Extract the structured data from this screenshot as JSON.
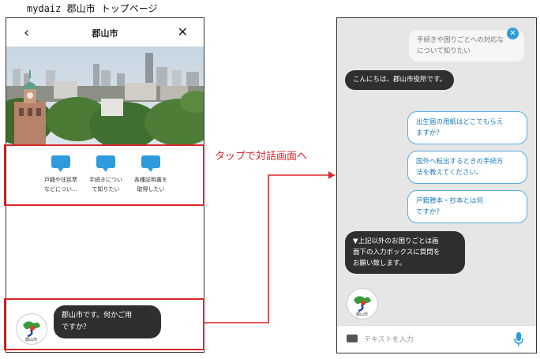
{
  "caption": "mydaiz 郡山市 トップページ",
  "left_phone": {
    "back_icon": "chevron-left-icon",
    "title": "郡山市",
    "close_icon": "close-icon",
    "photo": "city-skyline-photo",
    "actions": [
      {
        "icon": "speech-bubble-icon",
        "line1": "戸籍や住民票",
        "line2": "などについ…"
      },
      {
        "icon": "speech-bubble-icon",
        "line1": "手続きについ",
        "line2": "て知りたい"
      },
      {
        "icon": "speech-bubble-icon",
        "line1": "各種証明書を",
        "line2": "取得したい"
      }
    ],
    "greeting": {
      "line1": "郡山市です。何かご用",
      "line2": "ですか？"
    },
    "logo_text": "郡山市"
  },
  "annotation": {
    "arrow_label": "タップで対話画面へ",
    "accent_color": "#d9262b"
  },
  "right_phone": {
    "top_user_message": {
      "line1": "手続きや困りごとへの対応な",
      "line2": "について知りたい"
    },
    "bot_greeting": "こんにちは、郡山市役所です。",
    "suggestions": [
      {
        "line1": "出生届の用紙はどこでもらえ",
        "line2": "ますか？"
      },
      {
        "line1": "国外へ転出するときの手続方",
        "line2": "法を教えてください。"
      },
      {
        "line1": "戸籍謄本・抄本とは何",
        "line2": "ですか？"
      }
    ],
    "bot_notice": {
      "line1": "▼上記以外のお困りごとは画",
      "line2": "面下の入力ボックスに質問を",
      "line3": "お願い致します。"
    },
    "logo_text": "郡山市",
    "input_placeholder": "テキストを入力",
    "keyboard_icon": "keyboard-icon",
    "mic_icon": "microphone-icon",
    "close_badge_icon": "close-icon",
    "accent_color": "#2e9cdc"
  }
}
